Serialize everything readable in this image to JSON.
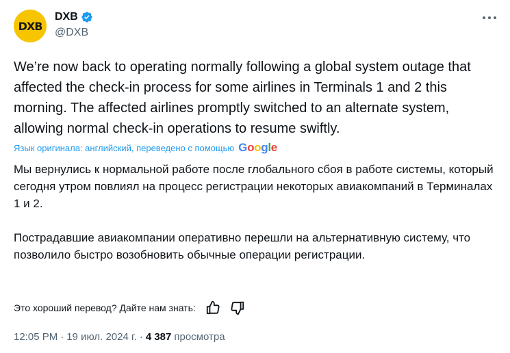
{
  "author": {
    "avatar_text": "DXB",
    "name": "DXB",
    "handle": "@DXB",
    "avatar_color": "#f7c500"
  },
  "tweet": {
    "text": "We’re now back to operating normally following a global system outage that affected the check-in process for some airlines in Terminals 1 and 2 this morning. The affected airlines promptly switched to an alternate system, allowing normal check-in operations to resume swiftly."
  },
  "translation_bar": {
    "label": "Язык оригинала: английский, переведено с помощью",
    "provider": "Google"
  },
  "translation": {
    "paragraphs": [
      "Мы вернулись к нормальной работе после глобального сбоя в работе системы, который сегодня утром повлиял на процесс регистрации некоторых авиакомпаний в Терминалах 1 и 2.",
      "Пострадавшие авиакомпании оперативно перешли на альтернативную систему, что позволило быстро возобновить обычные операции регистрации."
    ]
  },
  "feedback": {
    "question": "Это хороший перевод? Дайте нам знать:"
  },
  "meta": {
    "time": "12:05 PM",
    "separator": "·",
    "date": "19 июл. 2024 г.",
    "views_count": "4 387",
    "views_label": "просмотра"
  },
  "colors": {
    "link": "#1d9bf0",
    "secondary_text": "#536471",
    "primary_text": "#0f1419"
  },
  "icons": [
    "verified-badge-icon",
    "more-options-icon",
    "thumbs-up-icon",
    "thumbs-down-icon"
  ]
}
